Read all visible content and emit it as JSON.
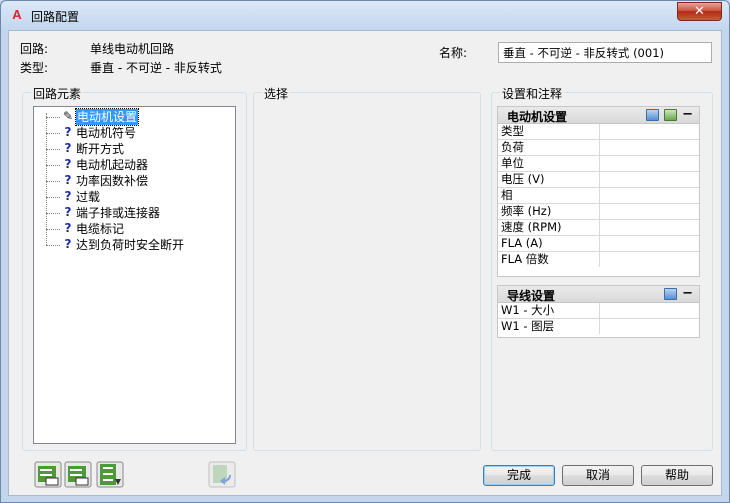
{
  "window": {
    "title": "回路配置",
    "close_glyph": "✕"
  },
  "header": {
    "circuit_label": "回路:",
    "circuit_value": "单线电动机回路",
    "type_label": "类型:",
    "type_value": "垂直 - 不可逆 - 非反转式",
    "name_label": "名称:",
    "name_value": "垂直 - 不可逆 - 非反转式 (001)"
  },
  "groups": {
    "elements": "回路元素",
    "selection": "选择",
    "settings": "设置和注释"
  },
  "tree": [
    {
      "icon": "pencil-icon",
      "glyph": "✎",
      "label": "电动机设置",
      "selected": true
    },
    {
      "icon": "question-icon",
      "glyph": "?",
      "label": "电动机符号"
    },
    {
      "icon": "question-icon",
      "glyph": "?",
      "label": "断开方式"
    },
    {
      "icon": "question-icon",
      "glyph": "?",
      "label": "电动机起动器"
    },
    {
      "icon": "question-icon",
      "glyph": "?",
      "label": "功率因数补偿"
    },
    {
      "icon": "question-icon",
      "glyph": "?",
      "label": "过载"
    },
    {
      "icon": "question-icon",
      "glyph": "?",
      "label": "端子排或连接器"
    },
    {
      "icon": "question-icon",
      "glyph": "?",
      "label": "电缆标记"
    },
    {
      "icon": "question-icon",
      "glyph": "?",
      "label": "达到负荷时安全断开"
    }
  ],
  "motor_panel": {
    "title": "电动机设置",
    "collapse": "−",
    "rows": [
      "类型",
      "负荷",
      "单位",
      "电压 (V)",
      "相",
      "频率 (Hz)",
      "速度 (RPM)",
      "FLA (A)",
      "FLA 倍数"
    ]
  },
  "wire_panel": {
    "title": "导线设置",
    "collapse": "−",
    "rows": [
      "W1 - 大小",
      "W1 - 图层"
    ]
  },
  "buttons": {
    "ok": "完成",
    "cancel": "取消",
    "help": "帮助"
  },
  "icons": [
    "insert-before-icon",
    "insert-after-icon",
    "insert-branch-icon",
    "undo-icon"
  ]
}
